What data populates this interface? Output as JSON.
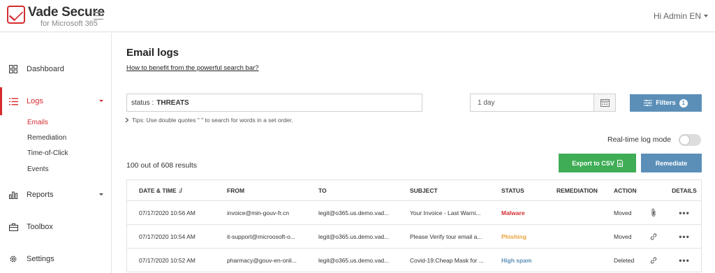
{
  "header": {
    "brand": "Vade Secure",
    "subbrand": "for Microsoft 365",
    "user_greeting": "Hi Admin EN"
  },
  "sidebar": {
    "items": [
      {
        "label": "Dashboard",
        "icon": "grid-icon"
      },
      {
        "label": "Logs",
        "icon": "list-icon",
        "active": true
      },
      {
        "label": "Reports",
        "icon": "bar-chart-icon"
      },
      {
        "label": "Toolbox",
        "icon": "toolbox-icon"
      },
      {
        "label": "Settings",
        "icon": "gear-icon"
      }
    ],
    "logs_sub": [
      "Emails",
      "Remediation",
      "Time-of-Click",
      "Events"
    ]
  },
  "main": {
    "title": "Email logs",
    "help_link": "How to benefit from the powerful search bar?",
    "search_key": "status :",
    "search_value": "THREATS",
    "date_range": "1 day",
    "filters_label": "Filters",
    "filters_count": "1",
    "tips": "Tips: Use double quotes \" \" to search for words in a set order.",
    "realtime_label": "Real-time log mode",
    "results": "100 out of 608 results",
    "export_label": "Export to CSV",
    "remediate_label": "Remediate"
  },
  "table": {
    "headers": [
      "DATE & TIME",
      "FROM",
      "TO",
      "SUBJECT",
      "STATUS",
      "REMEDIATION",
      "ACTION",
      "DETAILS"
    ],
    "rows": [
      {
        "date": "07/17/2020 10:56 AM",
        "from": "invoice@min-gouv-fr.cn",
        "to": "legit@o365.us.demo.vad...",
        "subject": "Your Invoice - Last Warni...",
        "status": "Malware",
        "remediation": "",
        "action": "Moved",
        "attachment": "paperclip-icon"
      },
      {
        "date": "07/17/2020 10:54 AM",
        "from": "it-support@microosoft-o...",
        "to": "legit@o365.us.demo.vad...",
        "subject": "Please Verify tour email a...",
        "status": "Phishing",
        "remediation": "",
        "action": "Moved",
        "attachment": "link-icon"
      },
      {
        "date": "07/17/2020 10:52 AM",
        "from": "pharmacy@gouv-en-onli...",
        "to": "legit@o365.us.demo.vad...",
        "subject": "Covid-19:Cheap Mask for ...",
        "status": "High spam",
        "remediation": "",
        "action": "Deleted",
        "attachment": "link-icon"
      }
    ]
  },
  "colors": {
    "brand_red": "#d52b2f",
    "button_blue": "#5b8fb8",
    "button_green": "#3fad56",
    "phishing_orange": "#e9a23b"
  }
}
